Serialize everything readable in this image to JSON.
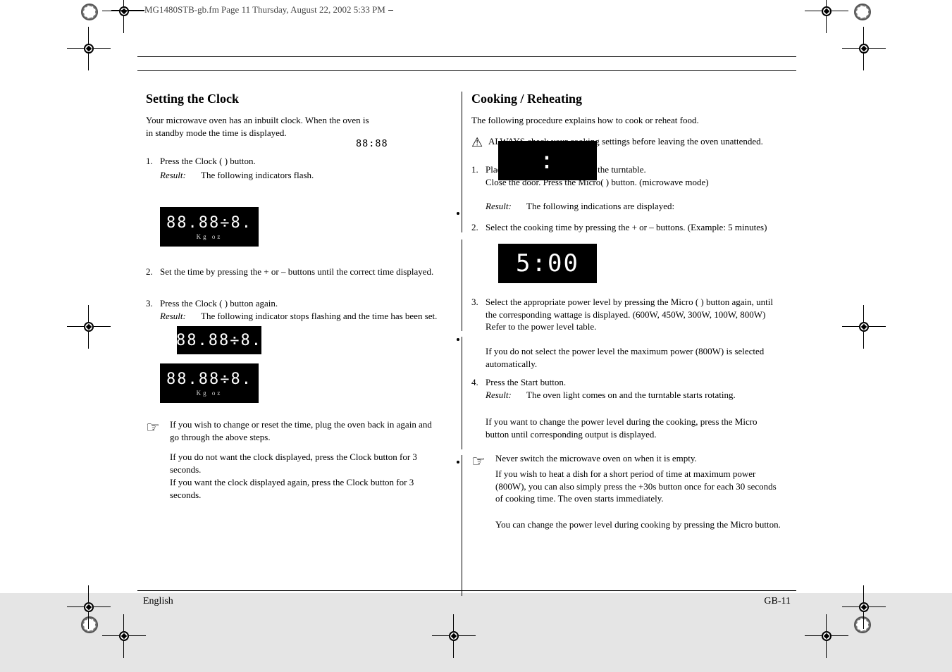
{
  "file_header": "MG1480STB-gb.fm  Page 11  Thursday, August 22, 2002  5:33 PM",
  "page": {
    "footer_left": "English",
    "footer_right": "GB-11"
  },
  "left_column": {
    "heading": "Setting the Clock",
    "intro": "Your microwave oven has an inbuilt clock. When the oven is in standby mode the time is displayed.",
    "clock_icon": "88:88",
    "step1_num": "1.",
    "step1": "Press the Clock ( ) button.",
    "result": "Result:",
    "step1_result": "The following indicators flash.",
    "lcd1": {
      "segments": "88.88÷8.",
      "sub": "Kg      oz"
    },
    "step2_num": "2.",
    "step2": "Set the time by pressing the + or – buttons until the correct time displayed.",
    "step3_num": "3.",
    "step3": "Press the Clock ( ) button again.",
    "step3_result": "The following indicator stops flashing and the time has been set.",
    "lcd2": {
      "segments": "88.88÷8."
    },
    "lcd3": {
      "segments": "88.88÷8.",
      "sub": "Kg      oz"
    },
    "tip_icon": "☞",
    "tip1": "If you wish to change or reset the time, plug the oven back in again and go through the above steps.",
    "tip2": "If you do not want the clock displayed, press the Clock button for 3 seconds.",
    "tip3": "If you want the clock displayed again, press the Clock button for 3 seconds."
  },
  "right_column": {
    "heading": "Cooking / Reheating",
    "intro": "The following procedure explains how to cook or reheat food.",
    "caution_icon": "⚠",
    "caution": "ALWAYS check your cooking settings before leaving the oven unattended.",
    "step1_num": "1.",
    "step1a": "Place the food in the centre of the turntable.",
    "step1b": "Close the door. Press the Micro( ) button. (microwave mode)",
    "step1_result": "The following indications are displayed:",
    "lcd_blank": ":",
    "step2_num": "2.",
    "step2": "Select the cooking time by pressing the + or – buttons. (Example: 5 minutes)",
    "lcd_time": "5:00",
    "step3_num": "3.",
    "step3": "Select the appropriate power level by pressing the Micro ( ) button again, until the corresponding wattage is displayed. (600W, 450W, 300W, 100W, 800W) Refer to the power level table.",
    "bullet1": "If you do not select the power level the maximum power (800W) is selected automatically.",
    "step4_num": "4.",
    "step4": "Press the Start button.",
    "step4_result": "The oven light comes on and the turntable starts rotating.",
    "bullet2": "If you want to change the power level during the cooking, press the Micro button until corresponding output is displayed.",
    "note_icon": "☞",
    "note1": "Never switch the microwave oven on when it is empty.",
    "note2": "If you wish to heat a dish for a short period of time at maximum power (800W), you can also simply press the +30s button once for each 30 seconds of cooking time. The oven starts immediately.",
    "bullet3": "You can change the power level during cooking by pressing the Micro button."
  }
}
